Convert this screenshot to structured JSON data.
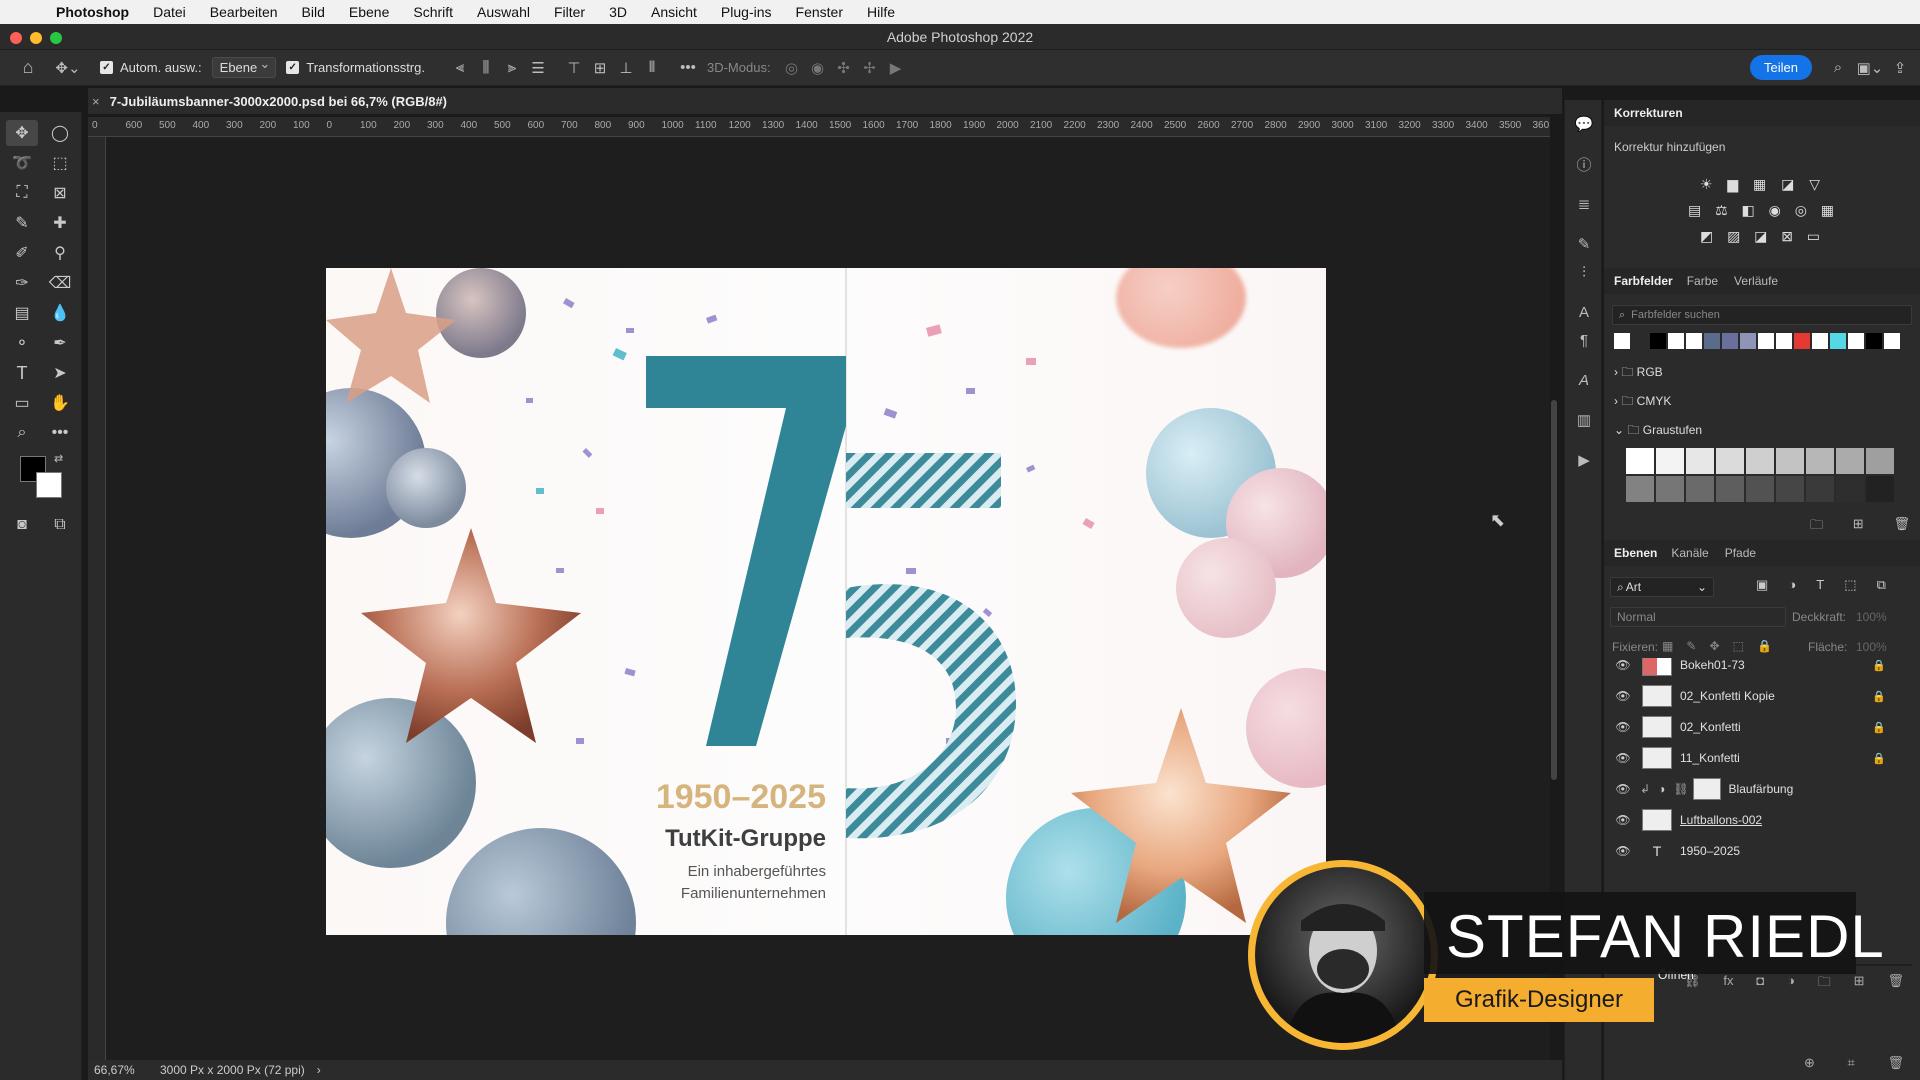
{
  "menubar": {
    "app": "Photoshop",
    "items": [
      "Datei",
      "Bearbeiten",
      "Bild",
      "Ebene",
      "Schrift",
      "Auswahl",
      "Filter",
      "3D",
      "Ansicht",
      "Plug-ins",
      "Fenster",
      "Hilfe"
    ]
  },
  "window": {
    "title": "Adobe Photoshop 2022"
  },
  "options": {
    "auto_select_label": "Autom. ausw.:",
    "auto_select_value": "Ebene",
    "transform_label": "Transformationsstrg.",
    "mode3d_label": "3D-Modus:",
    "share_label": "Teilen"
  },
  "document": {
    "tab_title": "7-Jubiläumsbanner-3000x2000.psd bei 66,7% (RGB/8#)"
  },
  "ruler": {
    "marks": [
      "0",
      "600",
      "500",
      "400",
      "300",
      "200",
      "100",
      "0",
      "100",
      "200",
      "300",
      "400",
      "500",
      "600",
      "700",
      "800",
      "900",
      "1000",
      "1100",
      "1200",
      "1300",
      "1400",
      "1500",
      "1600",
      "1700",
      "1800",
      "1900",
      "2000",
      "2100",
      "2200",
      "2300",
      "2400",
      "2500",
      "2600",
      "2700",
      "2800",
      "2900",
      "3000",
      "3100",
      "3200",
      "3300",
      "3400",
      "3500",
      "360"
    ]
  },
  "banner": {
    "years": "1950–2025",
    "company": "TutKit-Gruppe",
    "tagline1": "Ein inhabergeführtes",
    "tagline2": "Familienunternehmen",
    "colors": {
      "teal": "#2f8596",
      "gold": "#d6b47e",
      "text": "#4a4a4a"
    }
  },
  "status": {
    "zoom": "66,67%",
    "size": "3000 Px x 2000 Px (72 ppi)"
  },
  "korrekturen": {
    "title": "Korrekturen",
    "subtitle": "Korrektur hinzufügen"
  },
  "farbfelder": {
    "tabs": [
      "Farbfelder",
      "Farbe",
      "Verläufe"
    ],
    "search_placeholder": "Farbfelder suchen",
    "groups": [
      "RGB",
      "CMYK",
      "Graustufen"
    ],
    "swatches": [
      "#ffffff",
      "#2b2b2b",
      "#000000",
      "#ffffff",
      "#ffffff",
      "#5a6b8c",
      "#6a6f9e",
      "#8e95b8",
      "#ffffff",
      "#ffffff",
      "#e53935",
      "#ffffff",
      "#55d8e6",
      "#ffffff",
      "#000000",
      "#ffffff"
    ]
  },
  "ebenen": {
    "tabs": [
      "Ebenen",
      "Kanäle",
      "Pfade"
    ],
    "filter_label": "Art",
    "blend_mode": "Normal",
    "opacity_label": "Deckkraft:",
    "opacity_value": "100%",
    "lock_label": "Fixieren:",
    "fill_label": "Fläche:",
    "fill_value": "100%",
    "layers": [
      {
        "name": "Bokeh01-73"
      },
      {
        "name": "02_Konfetti Kopie"
      },
      {
        "name": "02_Konfetti"
      },
      {
        "name": "11_Konfetti"
      },
      {
        "name": "Blaufärbung"
      },
      {
        "name": "Luftballons-002"
      },
      {
        "name": "1950–2025"
      }
    ]
  },
  "lower_panel": {
    "open_label": "Öffnen"
  },
  "overlay": {
    "name": "STEFAN RIEDL",
    "role": "Grafik-Designer"
  }
}
